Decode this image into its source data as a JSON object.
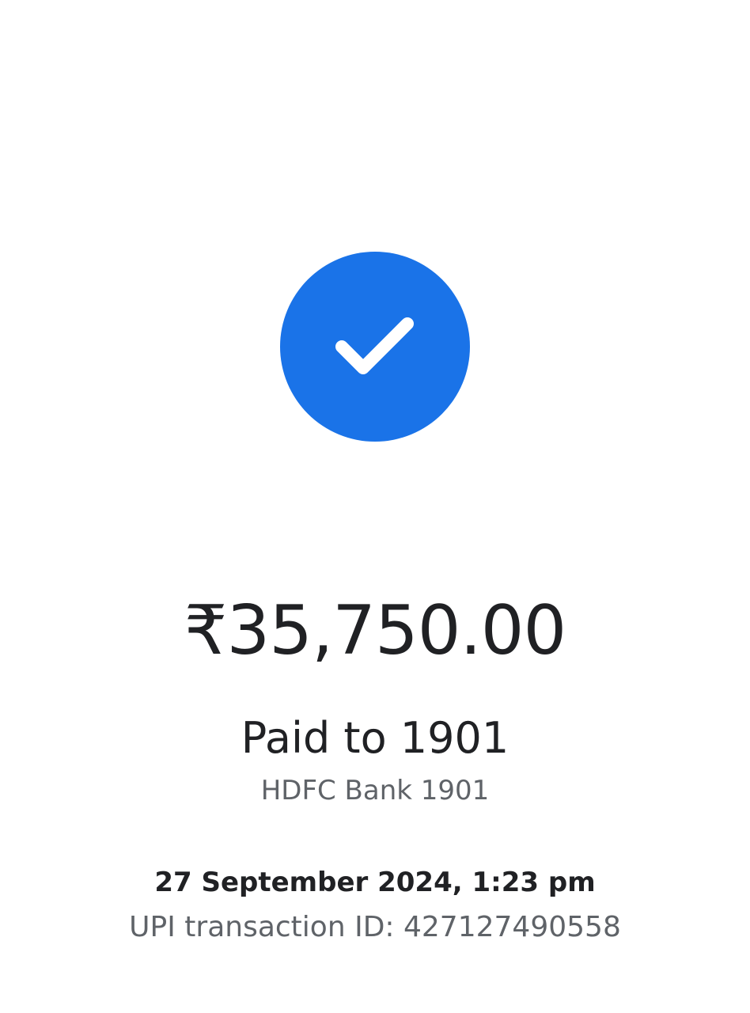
{
  "status": {
    "icon": "checkmark-icon",
    "circle_color": "#1a73e8"
  },
  "payment": {
    "amount": "₹35,750.00",
    "paid_to": "Paid to 1901",
    "bank": "HDFC Bank 1901",
    "datetime": "27 September 2024, 1:23 pm",
    "upi_transaction": "UPI transaction ID: 427127490558"
  }
}
